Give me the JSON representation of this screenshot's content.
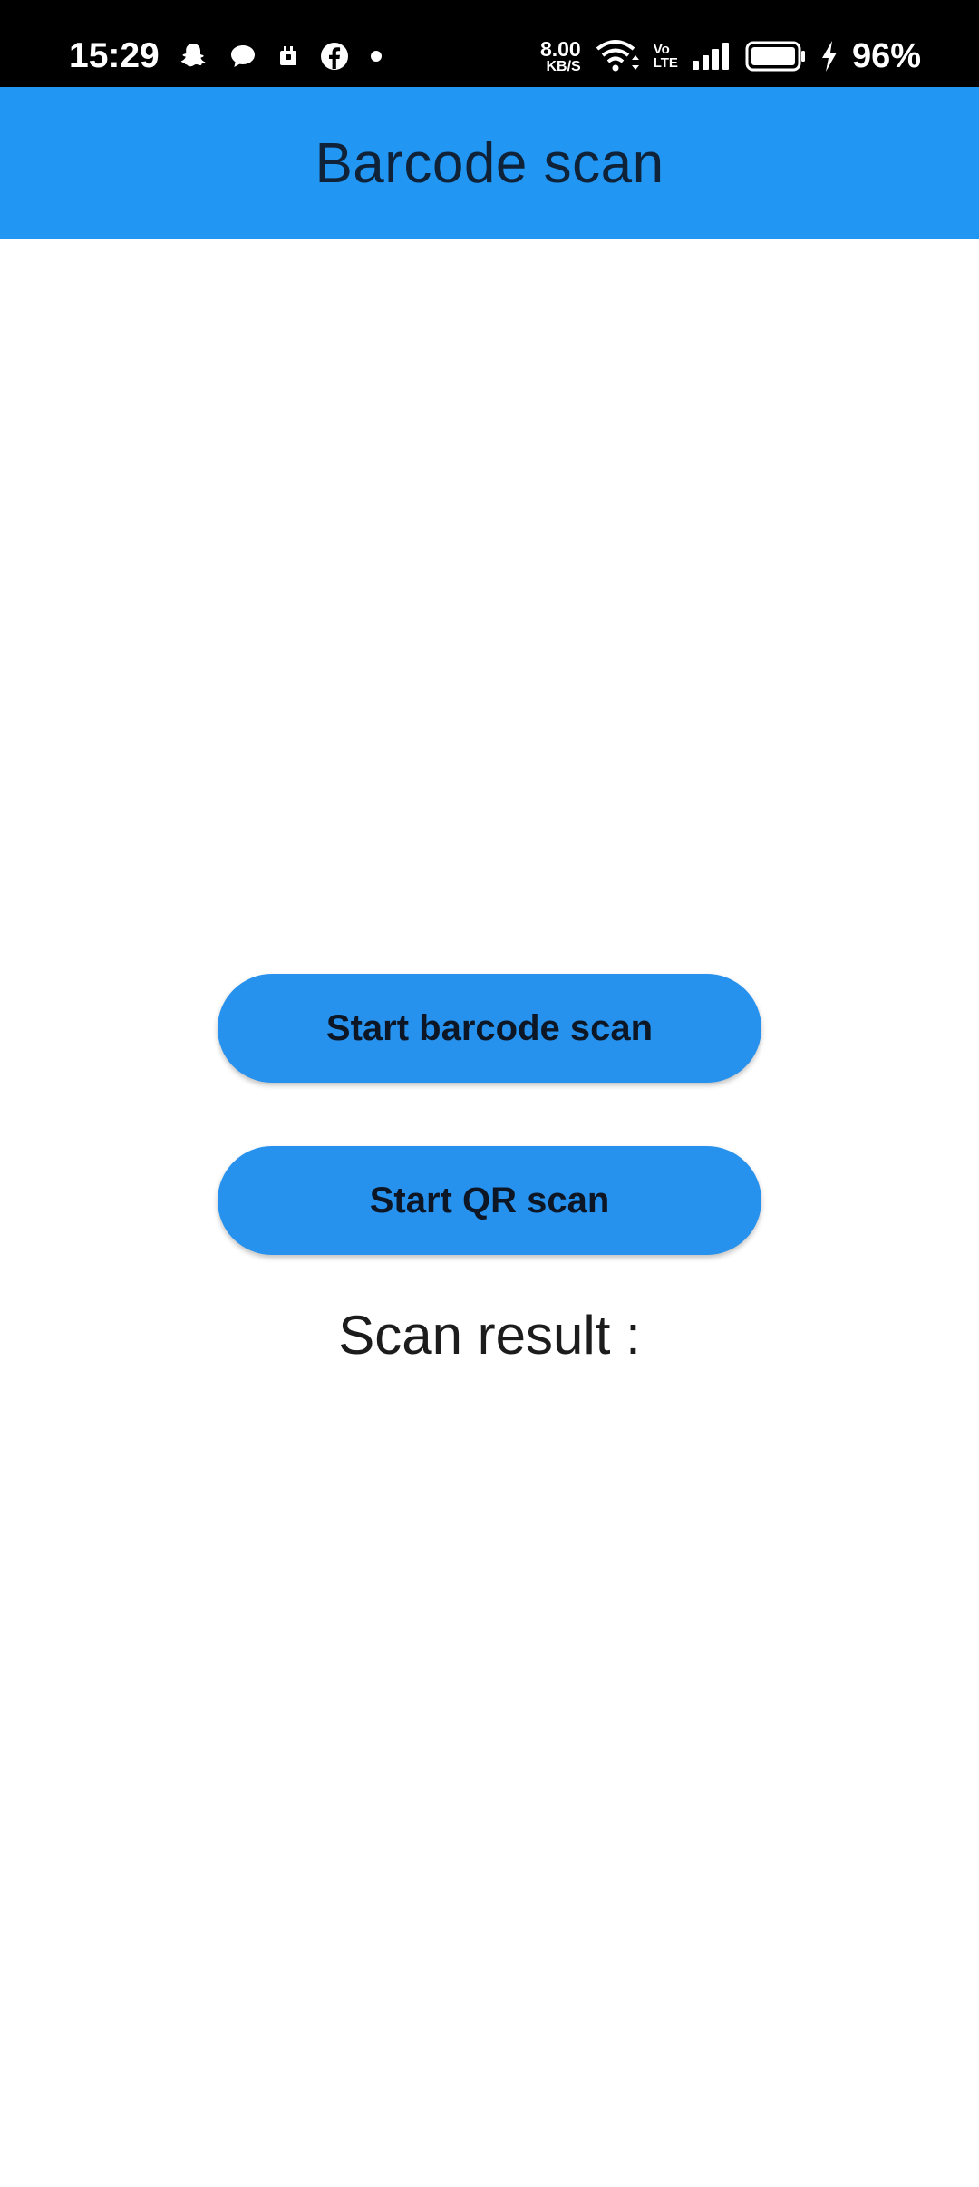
{
  "status_bar": {
    "time": "15:29",
    "net_speed_value": "8.00",
    "net_speed_unit": "KB/S",
    "volte_top": "Vo",
    "volte_bottom": "LTE",
    "battery_percent": "96%",
    "left_icons": [
      "snapchat-icon",
      "chat-bubble-icon",
      "camera-icon",
      "facebook-icon",
      "dot-icon"
    ],
    "right_icons": [
      "wifi-icon",
      "signal-icon",
      "battery-icon",
      "charging-icon"
    ]
  },
  "app_bar": {
    "title": "Barcode scan",
    "color": "#2196F3"
  },
  "main": {
    "barcode_button_label": "Start barcode scan",
    "qr_button_label": "Start QR scan",
    "scan_result_label": "Scan result :",
    "button_color": "#2692EE"
  }
}
